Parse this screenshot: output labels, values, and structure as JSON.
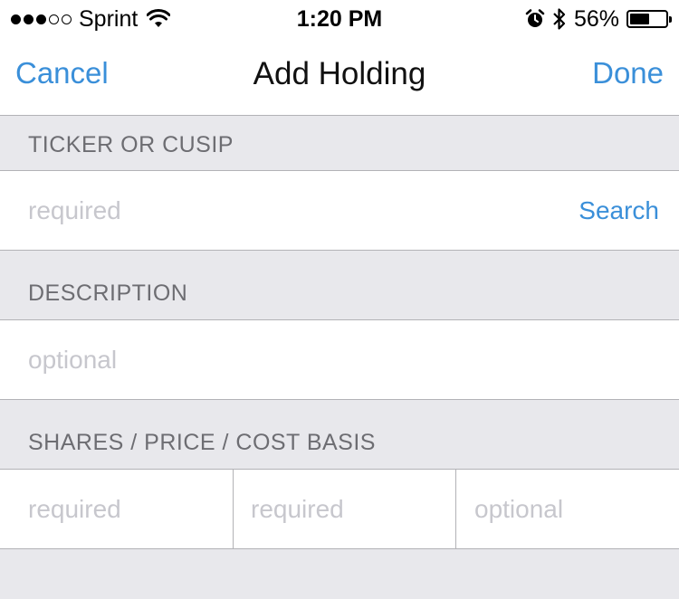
{
  "status_bar": {
    "signal_icon": "signal-bars-icon",
    "carrier": "Sprint",
    "wifi_icon": "wifi-icon",
    "time": "1:20 PM",
    "alarm_icon": "alarm-clock-icon",
    "bluetooth_icon": "bluetooth-icon",
    "battery_percent": "56%",
    "battery_level": 0.56
  },
  "nav": {
    "cancel_label": "Cancel",
    "title": "Add Holding",
    "done_label": "Done",
    "accent_color": "#3a8fd9"
  },
  "ticker_section": {
    "header": "TICKER OR CUSIP",
    "placeholder": "required",
    "search_label": "Search"
  },
  "description_section": {
    "header": "DESCRIPTION",
    "placeholder": "optional"
  },
  "position_section": {
    "header": "SHARES / PRICE / COST BASIS",
    "shares_placeholder": "required",
    "price_placeholder": "required",
    "cost_basis_placeholder": "optional"
  }
}
